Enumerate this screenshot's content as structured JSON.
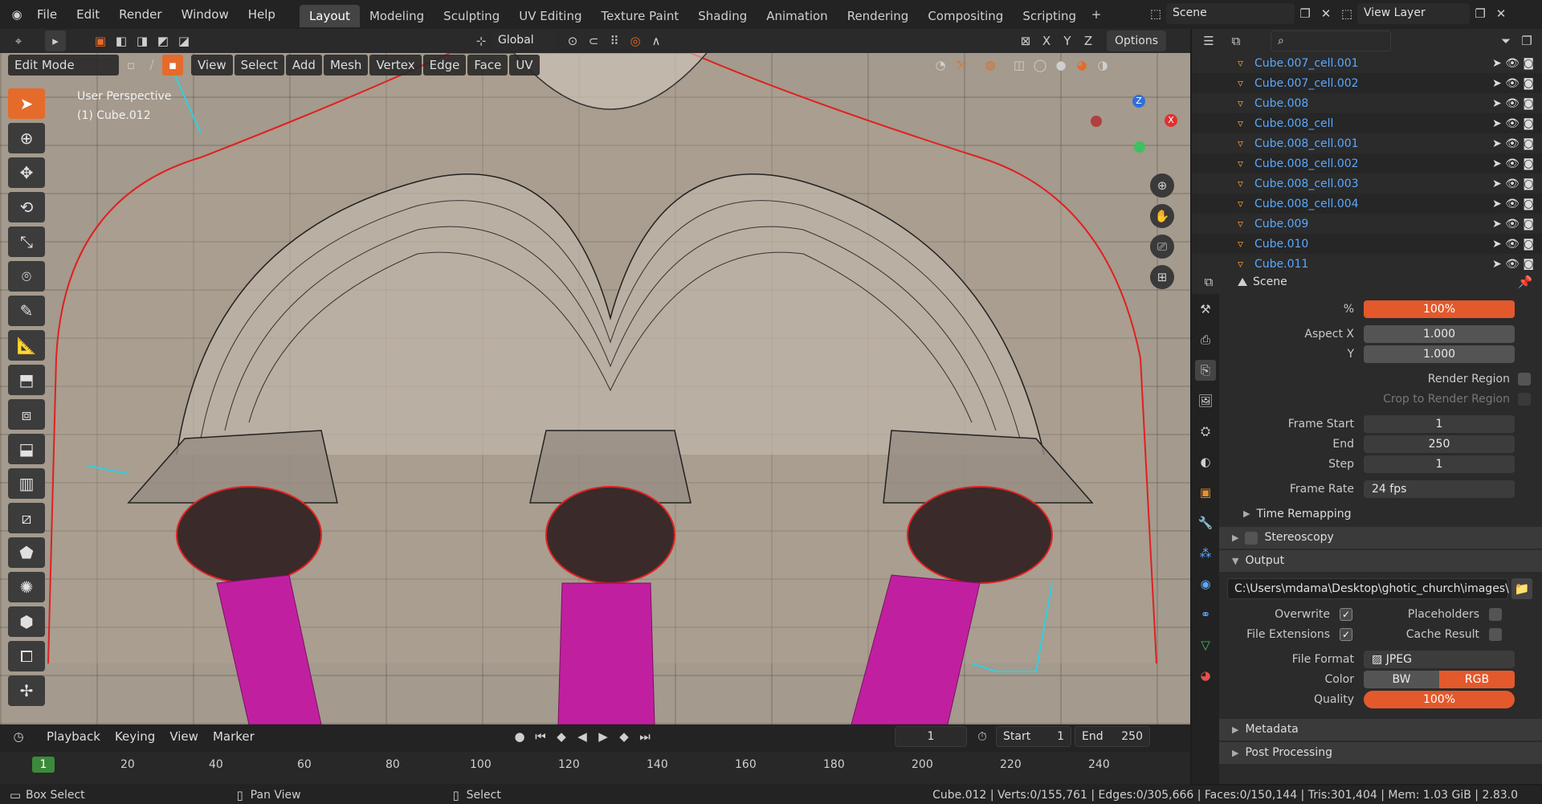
{
  "menu": [
    "File",
    "Edit",
    "Render",
    "Window",
    "Help"
  ],
  "workspaces": [
    "Layout",
    "Modeling",
    "Sculpting",
    "UV Editing",
    "Texture Paint",
    "Shading",
    "Animation",
    "Rendering",
    "Compositing",
    "Scripting"
  ],
  "active_workspace": "Layout",
  "scene": "Scene",
  "view_layer": "View Layer",
  "header": {
    "transform_orientation": "Global",
    "options_label": "Options",
    "axes": [
      "X",
      "Y",
      "Z"
    ]
  },
  "viewport": {
    "mode": "Edit Mode",
    "menu": [
      "View",
      "Select",
      "Add",
      "Mesh",
      "Vertex",
      "Edge",
      "Face",
      "UV"
    ],
    "overlay_text_1": "User Perspective",
    "overlay_text_2": "(1) Cube.012",
    "gizmo_axes": [
      "X",
      "Y",
      "Z"
    ]
  },
  "outliner": {
    "rows": [
      "Cube.007_cell.001",
      "Cube.007_cell.002",
      "Cube.008",
      "Cube.008_cell",
      "Cube.008_cell.001",
      "Cube.008_cell.002",
      "Cube.008_cell.003",
      "Cube.008_cell.004",
      "Cube.009",
      "Cube.010",
      "Cube.011"
    ]
  },
  "properties": {
    "context": "Scene",
    "resolution_percent_label": "%",
    "resolution_percent": "100%",
    "aspect_x_label": "Aspect X",
    "aspect_x": "1.000",
    "aspect_y_label": "Y",
    "aspect_y": "1.000",
    "render_region": "Render Region",
    "crop_region": "Crop to Render Region",
    "frame_start_label": "Frame Start",
    "frame_start": "1",
    "end_label": "End",
    "end": "250",
    "step_label": "Step",
    "step": "1",
    "frame_rate_label": "Frame Rate",
    "frame_rate": "24 fps",
    "time_remapping": "Time Remapping",
    "stereoscopy": "Stereoscopy",
    "output": "Output",
    "output_path": "C:\\Users\\mdama\\Desktop\\ghotic_church\\images\\",
    "overwrite": "Overwrite",
    "placeholders": "Placeholders",
    "file_extensions": "File Extensions",
    "cache_result": "Cache Result",
    "file_format_label": "File Format",
    "file_format": "JPEG",
    "color_label": "Color",
    "color_bw": "BW",
    "color_rgb": "RGB",
    "quality_label": "Quality",
    "quality": "100%",
    "metadata": "Metadata",
    "post_processing": "Post Processing"
  },
  "timeline": {
    "menus": [
      "Playback",
      "Keying",
      "View",
      "Marker"
    ],
    "current_frame": "1",
    "start_label": "Start",
    "start": "1",
    "end_label": "End",
    "end": "250",
    "ticks": [
      "1",
      "20",
      "40",
      "60",
      "80",
      "100",
      "120",
      "140",
      "160",
      "180",
      "200",
      "220",
      "240"
    ]
  },
  "status": {
    "left1": "Box Select",
    "left2": "Pan View",
    "left3": "Select",
    "stats": "Cube.012 | Verts:0/155,761 | Edges:0/305,666 | Faces:0/150,144 | Tris:301,404 | Mem: 1.03 GiB | 2.83.0"
  },
  "colors": {
    "accent": "#e56b2a",
    "outliner_text": "#5aa8ff",
    "column_magenta": "#c020a0",
    "edge_red": "#e02020",
    "stone": "#a49a8d"
  }
}
